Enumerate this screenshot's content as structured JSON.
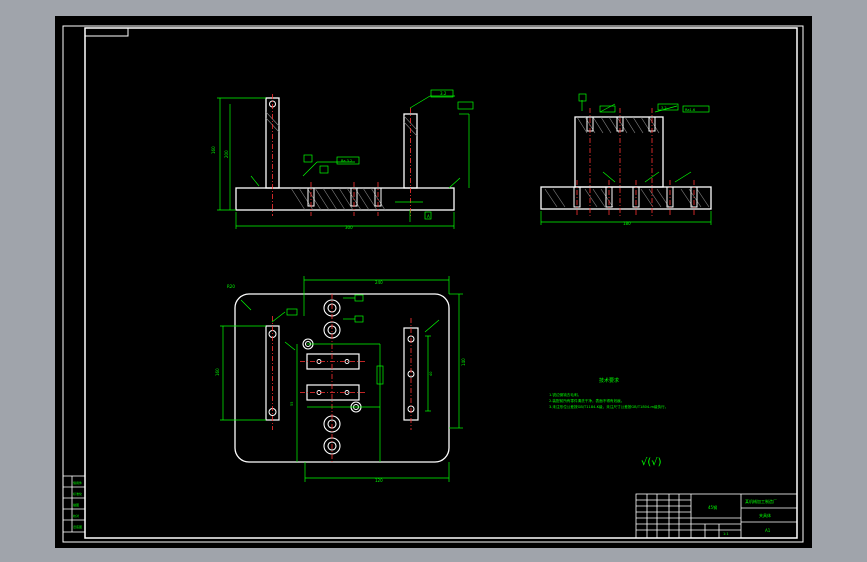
{
  "sheet": {
    "colors": {
      "background": "#000000",
      "border": "#ffffff",
      "outline": "#ffffff",
      "dimension": "#00ff00",
      "centerline": "#ff3333",
      "hatch": "#888888"
    }
  },
  "front_view": {
    "dim_width": "300",
    "dim_height": "160",
    "dim_inner": "200",
    "rough_label": "3.2",
    "datum": "A",
    "note_tag": "Ra 3.2"
  },
  "side_view": {
    "dim_width": "180",
    "rough_top": "3.2",
    "rough_right": "Ra1.6"
  },
  "top_view": {
    "label_r": "R20",
    "dim_top": "240",
    "dim_bottom": "120",
    "dim_left_h": "160",
    "dim_right_h": "140",
    "dim_mid": "55",
    "dim_small": "40"
  },
  "notes": {
    "title": "技术要求",
    "line1": "1.锐边倒钝去毛刺。",
    "line2": "2.装配前所有零件清洗干净，表面不得有划痕。",
    "line3": "3.未注形位公差按GB/T1184-K级，未注尺寸公差按GB/T1804-m级执行。",
    "roughness_symbol": "√(√)"
  },
  "title_block": {
    "material": "45钢",
    "school": "某机械加工制造厂",
    "drawing_name": "夹具体",
    "scale": "1:1",
    "sheet_no": "A1"
  },
  "left_table": {
    "rows": [
      "借用件",
      "标准化",
      "描图",
      "校对",
      "旧底图"
    ]
  }
}
